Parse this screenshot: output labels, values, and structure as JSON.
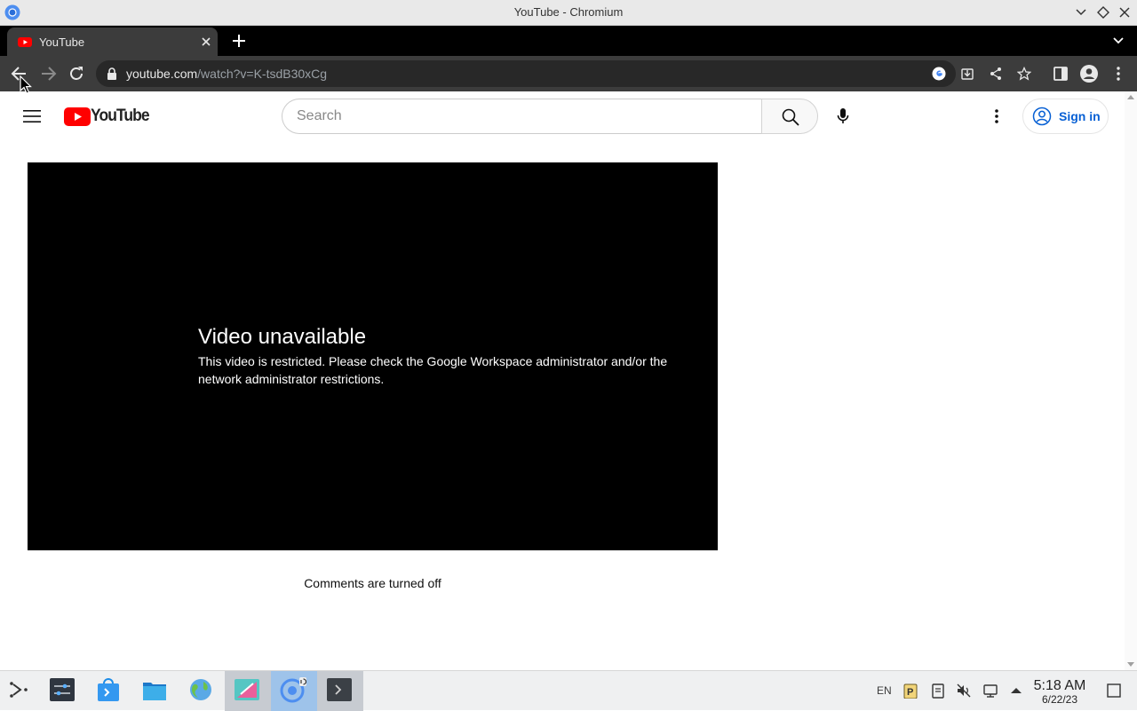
{
  "window": {
    "title": "YouTube - Chromium"
  },
  "tabs": [
    {
      "title": "YouTube"
    }
  ],
  "address_bar": {
    "url_host": "youtube.com",
    "url_path": "/watch?v=K-tsdB30xCg"
  },
  "youtube": {
    "logo_text": "YouTube",
    "search_placeholder": "Search",
    "sign_in_label": "Sign in"
  },
  "player": {
    "error_title": "Video unavailable",
    "error_message": "This video is restricted. Please check the Google Workspace administrator and/or the network administrator restrictions."
  },
  "comments_status": "Comments are turned off",
  "taskbar": {
    "language": "EN",
    "time": "5:18 AM",
    "date": "6/22/23"
  },
  "colors": {
    "youtube_red": "#ff0000",
    "link_blue": "#065fd4",
    "browser_toolbar": "#3c3c3c",
    "player_bg": "#000000"
  }
}
